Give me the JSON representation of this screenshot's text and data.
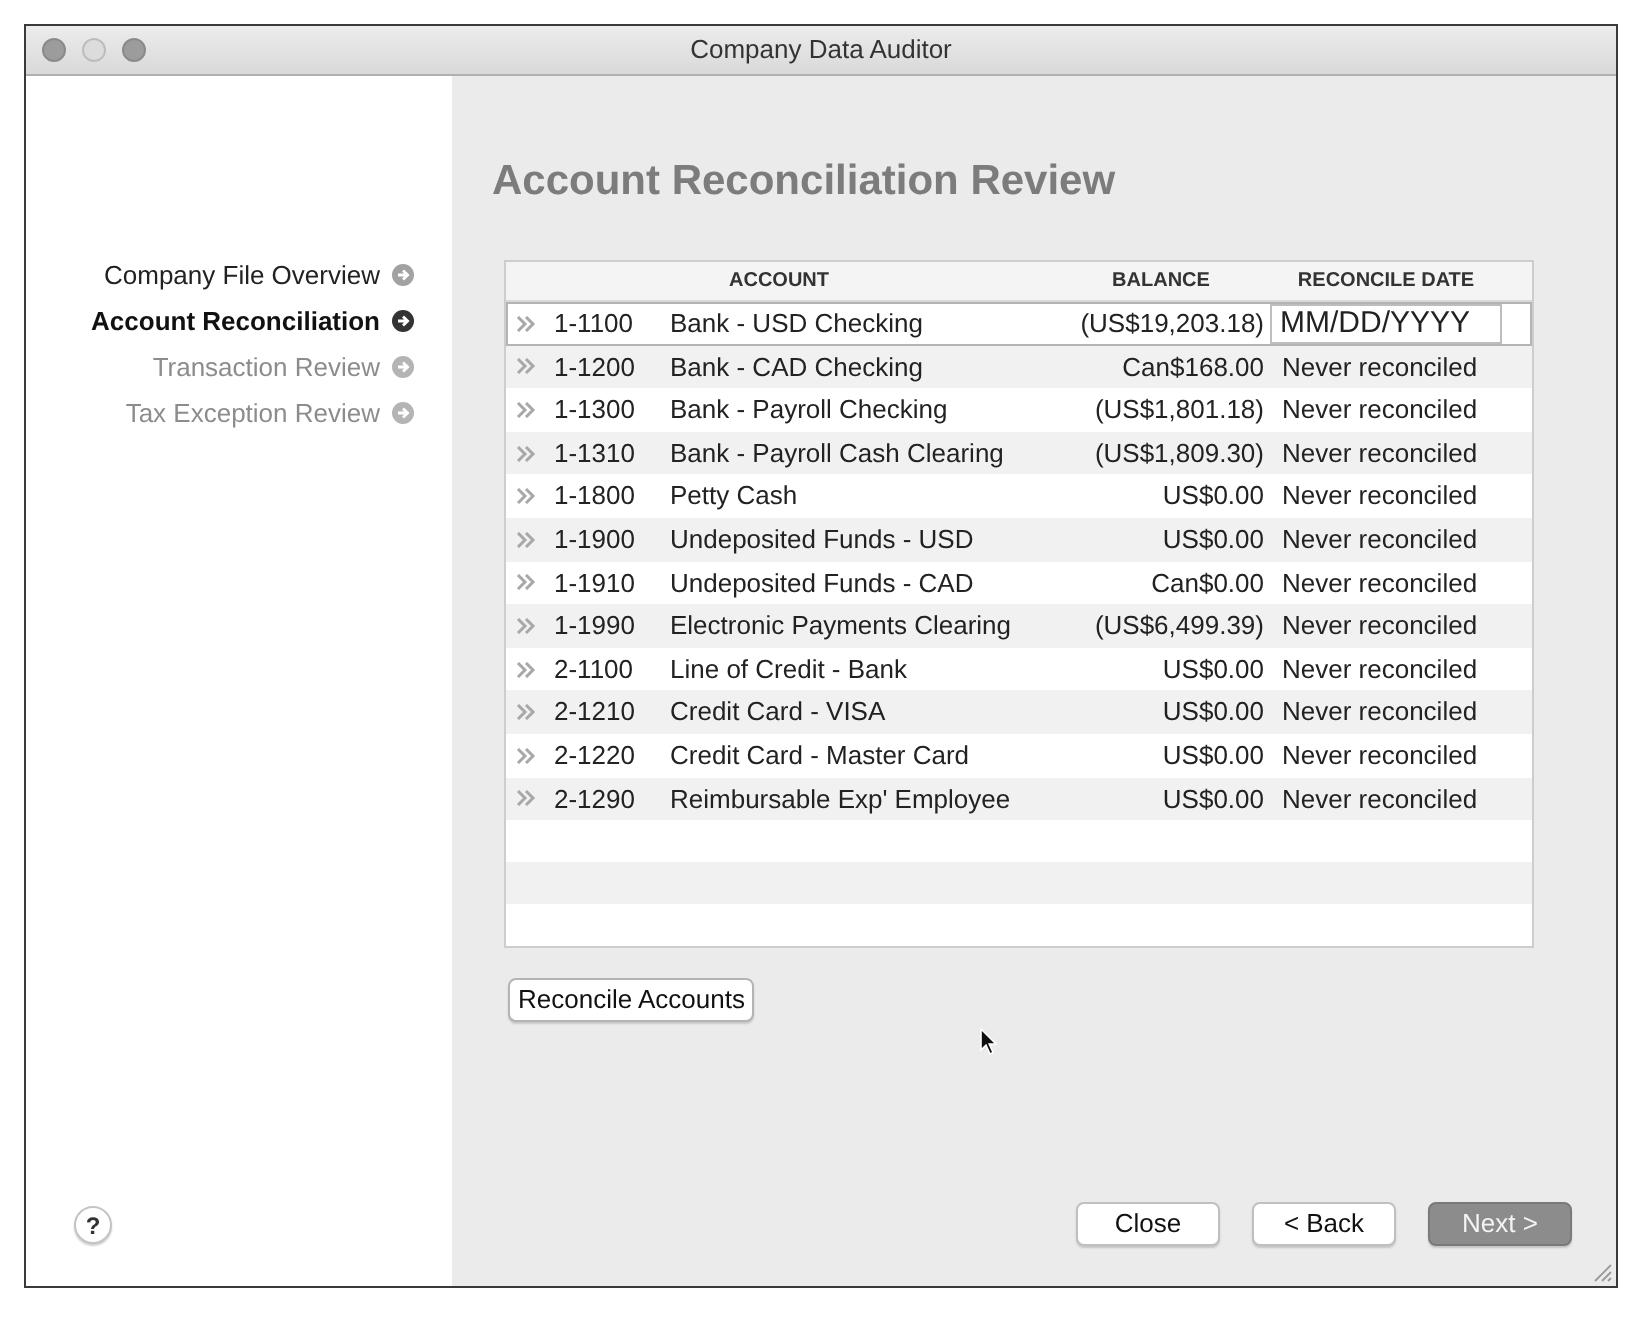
{
  "window": {
    "title": "Company Data Auditor",
    "controls": [
      {
        "disabled": false
      },
      {
        "disabled": true
      },
      {
        "disabled": false
      }
    ]
  },
  "sidebar": {
    "items": [
      {
        "label": "Company File Overview",
        "selected": false,
        "disabled": false
      },
      {
        "label": "Account Reconciliation",
        "selected": true,
        "disabled": false
      },
      {
        "label": "Transaction Review",
        "selected": false,
        "disabled": true
      },
      {
        "label": "Tax Exception Review",
        "selected": false,
        "disabled": true
      }
    ],
    "help_button": "?"
  },
  "main": {
    "heading": "Account Reconciliation Review",
    "table": {
      "columns": [
        "ACCOUNT",
        "BALANCE",
        "RECONCILE DATE"
      ],
      "rows": [
        {
          "number": "1-1100",
          "name": "Bank - USD Checking",
          "balance": "(US$19,203.18)",
          "reconcile_date": {
            "kind": "input",
            "placeholder": "MM/DD/YYYY"
          },
          "selected": true
        },
        {
          "number": "1-1200",
          "name": "Bank - CAD Checking",
          "balance": "Can$168.00",
          "reconcile_date": {
            "kind": "text",
            "text": "Never reconciled"
          },
          "selected": false
        },
        {
          "number": "1-1300",
          "name": "Bank - Payroll Checking",
          "balance": "(US$1,801.18)",
          "reconcile_date": {
            "kind": "text",
            "text": "Never reconciled"
          },
          "selected": false
        },
        {
          "number": "1-1310",
          "name": "Bank - Payroll Cash Clearing",
          "balance": "(US$1,809.30)",
          "reconcile_date": {
            "kind": "text",
            "text": "Never reconciled"
          },
          "selected": false
        },
        {
          "number": "1-1800",
          "name": "Petty Cash",
          "balance": "US$0.00",
          "reconcile_date": {
            "kind": "text",
            "text": "Never reconciled"
          },
          "selected": false
        },
        {
          "number": "1-1900",
          "name": "Undeposited Funds - USD",
          "balance": "US$0.00",
          "reconcile_date": {
            "kind": "text",
            "text": "Never reconciled"
          },
          "selected": false
        },
        {
          "number": "1-1910",
          "name": "Undeposited Funds - CAD",
          "balance": "Can$0.00",
          "reconcile_date": {
            "kind": "text",
            "text": "Never reconciled"
          },
          "selected": false
        },
        {
          "number": "1-1990",
          "name": "Electronic Payments Clearing",
          "balance": "(US$6,499.39)",
          "reconcile_date": {
            "kind": "text",
            "text": "Never reconciled"
          },
          "selected": false
        },
        {
          "number": "2-1100",
          "name": "Line of Credit - Bank",
          "balance": "US$0.00",
          "reconcile_date": {
            "kind": "text",
            "text": "Never reconciled"
          },
          "selected": false
        },
        {
          "number": "2-1210",
          "name": "Credit Card - VISA",
          "balance": "US$0.00",
          "reconcile_date": {
            "kind": "text",
            "text": "Never reconciled"
          },
          "selected": false
        },
        {
          "number": "2-1220",
          "name": "Credit Card - Master Card",
          "balance": "US$0.00",
          "reconcile_date": {
            "kind": "text",
            "text": "Never reconciled"
          },
          "selected": false
        },
        {
          "number": "2-1290",
          "name": "Reimbursable Exp' Employee",
          "balance": "US$0.00",
          "reconcile_date": {
            "kind": "text",
            "text": "Never reconciled"
          },
          "selected": false
        }
      ]
    },
    "action_button": "Reconcile Accounts",
    "buttons": [
      {
        "label": "Close",
        "default": false
      },
      {
        "label": "< Back",
        "default": false
      },
      {
        "label": "Next >",
        "default": true
      }
    ]
  }
}
